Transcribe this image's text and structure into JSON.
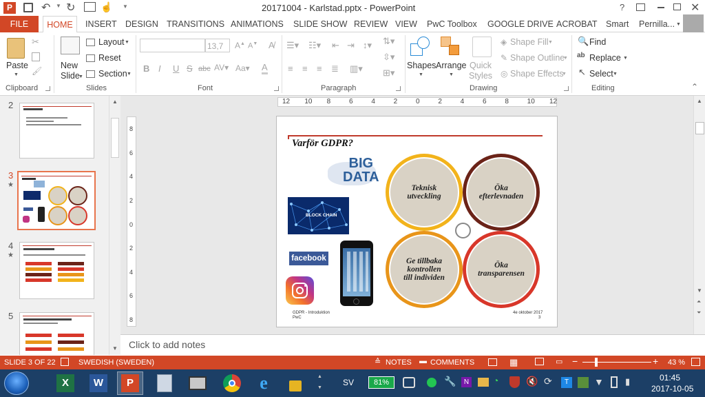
{
  "app": {
    "window_title": "20171004 - Karlstad.pptx - PowerPoint",
    "user": "Pernilla...",
    "help": "?"
  },
  "tabs": [
    "FILE",
    "HOME",
    "INSERT",
    "DESIGN",
    "TRANSITIONS",
    "ANIMATIONS",
    "SLIDE SHOW",
    "REVIEW",
    "VIEW",
    "PwC Toolbox",
    "GOOGLE DRIVE",
    "ACROBAT",
    "Smart"
  ],
  "active_tab": "HOME",
  "ribbon": {
    "clipboard": {
      "label": "Clipboard",
      "paste": "Paste"
    },
    "slides": {
      "label": "Slides",
      "new_slide": "New\nSlide",
      "layout": "Layout",
      "reset": "Reset",
      "section": "Section"
    },
    "font": {
      "label": "Font",
      "font_name": "",
      "font_size": "13,7",
      "bold": "B",
      "italic": "I",
      "underline": "U",
      "strike": "S",
      "shadow": "abc"
    },
    "paragraph": {
      "label": "Paragraph"
    },
    "drawing": {
      "label": "Drawing",
      "shapes": "Shapes",
      "arrange": "Arrange",
      "quick_styles": "Quick\nStyles",
      "shape_fill": "Shape Fill",
      "shape_outline": "Shape Outline",
      "shape_effects": "Shape Effects"
    },
    "editing": {
      "label": "Editing",
      "find": "Find",
      "replace": "Replace",
      "select": "Select"
    }
  },
  "thumbnails": [
    {
      "number": "2",
      "star": false
    },
    {
      "number": "3",
      "star": true,
      "selected": true
    },
    {
      "number": "4",
      "star": true
    },
    {
      "number": "5",
      "star": false
    }
  ],
  "ruler": {
    "labels": [
      "12",
      "10",
      "8",
      "6",
      "4",
      "2",
      "0",
      "2",
      "4",
      "6",
      "8",
      "10",
      "12"
    ]
  },
  "vruler": {
    "labels": [
      "8",
      "6",
      "4",
      "2",
      "0",
      "2",
      "4",
      "6",
      "8"
    ]
  },
  "slide": {
    "title": "Varför GDPR?",
    "big_data": "BIG DATA",
    "block_chain": "BLOCK CHAIN",
    "facebook": "facebook",
    "circle_tl": "Teknisk utveckling",
    "circle_tr": "Öka efterlevnaden",
    "circle_bl": "Ge tillbaka kontrollen till individen",
    "circle_br": "Öka transparensen",
    "footer_left_1": "GDPR - Introduktion",
    "footer_left_2": "PwC",
    "footer_right_1": "4e oktober 2017",
    "footer_right_2": "3",
    "colors": {
      "tl": "#f2b31b",
      "tr": "#6b2318",
      "bl": "#e8951a",
      "br": "#d8372a",
      "inner": "#d9d2c5",
      "line": "#c0392b"
    }
  },
  "notes_placeholder": "Click to add notes",
  "status": {
    "slide_of": "SLIDE 3 OF 22",
    "language": "SWEDISH (SWEDEN)",
    "notes": "NOTES",
    "comments": "COMMENTS",
    "zoom": "43 %",
    "zoom_level": 0.43
  },
  "taskbar": {
    "lang": "SV",
    "battery": "81%",
    "time": "01:45",
    "date": "2017-10-05"
  }
}
